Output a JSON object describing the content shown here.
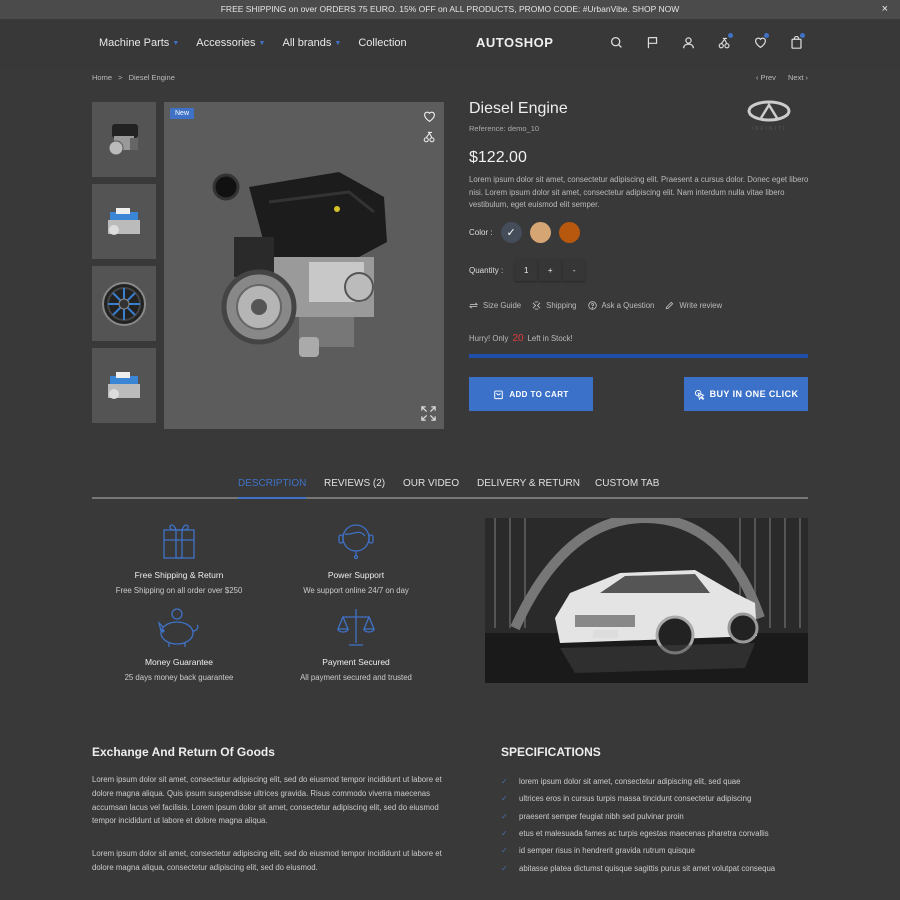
{
  "promo": {
    "text": "FREE SHIPPING on over ORDERS 75 EURO. 15% OFF on ALL PRODUCTS, PROMO CODE: #UrbanVibe. SHOP NOW",
    "close": "×"
  },
  "nav": {
    "items": [
      {
        "label": "Machine Parts",
        "dropdown": true
      },
      {
        "label": "Accessories",
        "dropdown": true
      },
      {
        "label": "All brands",
        "dropdown": true
      },
      {
        "label": "Collection",
        "dropdown": false
      }
    ]
  },
  "logo": "AUTOSHOP",
  "header_icons": [
    "search-icon",
    "flag-icon",
    "user-icon",
    "compare-icon",
    "heart-icon",
    "cart-icon"
  ],
  "breadcrumb": {
    "home": "Home",
    "separator": ">",
    "current": "Diesel Engine"
  },
  "pager": {
    "prev": "‹ Prev",
    "next": "Next ›"
  },
  "gallery": {
    "badge": "New",
    "thumbnails": [
      "engine",
      "v8-engine",
      "wheel",
      "v8-engine"
    ]
  },
  "product": {
    "title": "Diesel Engine",
    "reference": "Reference: demo_10",
    "brand": "Infiniti",
    "price": "$122.00",
    "description": "Lorem ipsum dolor sit amet, consectetur adipiscing elit. Praesent a cursus dolor. Donec eget libero nisi. Lorem ipsum dolor sit amet, consectetur adipiscing elit. Nam interdum nulla vitae libero vestibulum, eget euismod elit semper.",
    "color_label": "Color :",
    "colors": [
      {
        "hex": "#454c5a",
        "selected": true
      },
      {
        "hex": "#d5a673",
        "selected": false
      },
      {
        "hex": "#b8580e",
        "selected": false
      }
    ],
    "quantity_label": "Quantity :",
    "quantity": "1",
    "plus": "+",
    "minus": "-",
    "links": [
      "Size Guide",
      "Shipping",
      "Ask a Question",
      "Write review"
    ],
    "stock_prefix": "Hurry! Only",
    "stock_count": "20",
    "stock_suffix": "Left in Stock!",
    "stock_fill_percent": 100,
    "add_to_cart": "ADD TO CART",
    "buy_one_click": "BUY IN ONE CLICK"
  },
  "tabs": [
    {
      "label": "DESCRIPTION",
      "active": true
    },
    {
      "label": "REVIEWS (2)",
      "active": false
    },
    {
      "label": "OUR VIDEO",
      "active": false
    },
    {
      "label": "DELIVERY & RETURN",
      "active": false
    },
    {
      "label": "CUSTOM TAB",
      "active": false
    }
  ],
  "features": [
    {
      "title": "Free Shipping & Return",
      "desc": "Free Shipping on all order over $250",
      "icon": "gift-icon"
    },
    {
      "title": "Power Support",
      "desc": "We support online 24/7 on day",
      "icon": "headset-icon"
    },
    {
      "title": "Money Guarantee",
      "desc": "25 days money back guarantee",
      "icon": "piggy-bank-icon"
    },
    {
      "title": "Payment Secured",
      "desc": "All payment secured and trusted",
      "icon": "scales-icon"
    }
  ],
  "exchange": {
    "title": "Exchange And Return Of Goods",
    "p1": "Lorem ipsum dolor sit amet, consectetur adipiscing elit, sed do eiusmod tempor incididunt ut labore et dolore magna aliqua. Quis ipsum suspendisse ultrices gravida. Risus commodo viverra maecenas accumsan lacus vel facilisis. Lorem ipsum dolor sit amet, consectetur adipiscing elit, sed do eiusmod tempor incididunt ut labore et dolore magna aliqua.",
    "p2": "Lorem ipsum dolor sit amet, consectetur adipiscing elit, sed do eiusmod tempor incididunt ut labore et dolore magna aliqua, consectetur adipiscing elit, sed do eiusmod."
  },
  "specs": {
    "title": "SPECIFICATIONS",
    "items": [
      "lorem ipsum dolor sit amet, consectetur adipiscing elit, sed quae",
      "ultrices eros in cursus turpis massa tincidunt consectetur adipiscing",
      "praesent semper feugiat nibh sed pulvinar proin",
      "etus et malesuada fames ac turpis egestas maecenas pharetra convallis",
      "id semper risus in hendrerit gravida rutrum quisque",
      "abitasse platea dictumst quisque sagittis purus sit amet volutpat consequa"
    ]
  }
}
